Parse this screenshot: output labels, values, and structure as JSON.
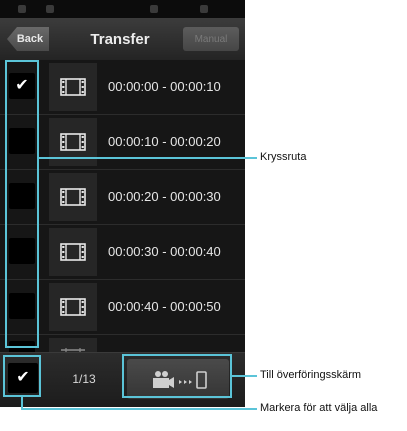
{
  "header": {
    "back_label": "Back",
    "title": "Transfer",
    "manual_label": "Manual"
  },
  "rows": [
    {
      "time": "00:00:00 - 00:00:10",
      "checked": true
    },
    {
      "time": "00:00:10 - 00:00:20",
      "checked": false
    },
    {
      "time": "00:00:20 - 00:00:30",
      "checked": false
    },
    {
      "time": "00:00:30 - 00:00:40",
      "checked": false
    },
    {
      "time": "00:00:40 - 00:00:50",
      "checked": false
    }
  ],
  "footer": {
    "page_indicator": "1/13",
    "select_all_checked": true
  },
  "callouts": {
    "checkbox": "Kryssruta",
    "transfer_screen": "Till överföringsskärm",
    "select_all": "Markera för att välja alla"
  },
  "colors": {
    "highlight": "#5bc4d8",
    "screen_bg": "#141414"
  },
  "icons": {
    "check": "checkmark-icon",
    "thumbnail": "film-icon",
    "transfer": "camera-to-phone-icon"
  }
}
